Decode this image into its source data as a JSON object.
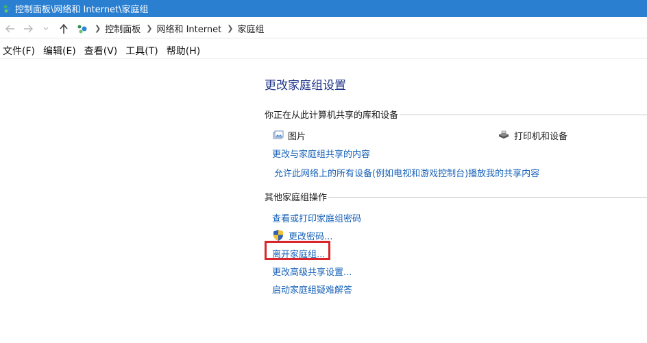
{
  "window": {
    "title": "控制面板\\网络和 Internet\\家庭组"
  },
  "addressbar": {
    "breadcrumbs": [
      "控制面板",
      "网络和 Internet",
      "家庭组"
    ]
  },
  "menubar": {
    "items": [
      "文件(F)",
      "编辑(E)",
      "查看(V)",
      "工具(T)",
      "帮助(H)"
    ]
  },
  "main": {
    "title": "更改家庭组设置",
    "sharing_section": {
      "heading": "你正在从此计算机共享的库和设备",
      "libraries": [
        {
          "label": "图片",
          "icon": "pictures-icon"
        },
        {
          "label": "打印机和设备",
          "icon": "printer-icon"
        }
      ],
      "links": [
        "更改与家庭组共享的内容",
        "允许此网络上的所有设备(例如电视和游戏控制台)播放我的共享内容"
      ]
    },
    "other_section": {
      "heading": "其他家庭组操作",
      "links": [
        "查看或打印家庭组密码",
        "更改密码...",
        "离开家庭组...",
        "更改高级共享设置...",
        "启动家庭组疑难解答"
      ]
    }
  },
  "colors": {
    "titlebar": "#2b7fd1",
    "link": "#1660b8",
    "heading": "#1e3287",
    "highlight": "#d9262c"
  }
}
